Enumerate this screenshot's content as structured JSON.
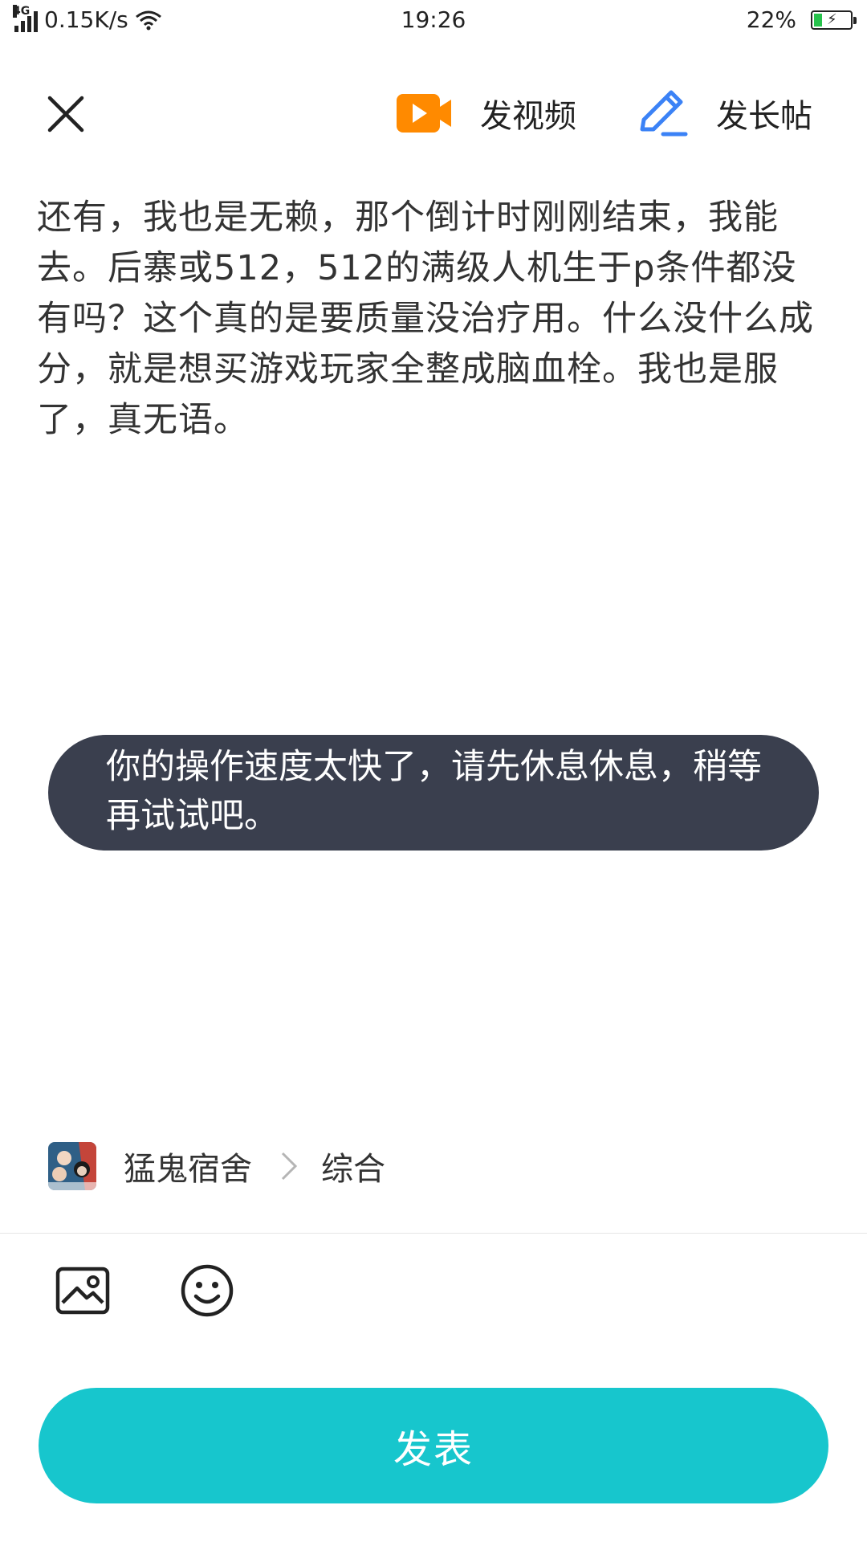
{
  "status_bar": {
    "network_type": "4G",
    "speed": "0.15K/s",
    "time": "19:26",
    "battery": "22%",
    "battery_level": 0.22,
    "icons": [
      "signal-icon",
      "wifi-icon",
      "battery-charging-icon"
    ]
  },
  "toolbar": {
    "close_icon": "close-icon",
    "video_label": "发视频",
    "video_icon": "video-camera-icon",
    "long_post_label": "发长帖",
    "long_post_icon": "pen-icon",
    "accent_video": "#ff8a00",
    "accent_pen": "#3b82f6"
  },
  "post": {
    "body": "还有，我也是无赖，那个倒计时刚刚结束，我能去。后寨或512，512的满级人机生于p条件都没有吗？这个真的是要质量没治疗用。什么没什么成分，就是想买游戏玩家全整成脑血栓。我也是服了，真无语。"
  },
  "toast": {
    "message": "你的操作速度太快了，请先休息休息，稍等再试试吧。",
    "background": "#3a3f4e"
  },
  "category": {
    "game": "猛鬼宿舍",
    "section": "综合",
    "avatar_icon": "game-avatar",
    "chevron_icon": "chevron-right-icon"
  },
  "tools": {
    "image_icon": "image-icon",
    "emoji_icon": "emoji-icon"
  },
  "publish": {
    "label": "发表",
    "color": "#17c6cd"
  }
}
